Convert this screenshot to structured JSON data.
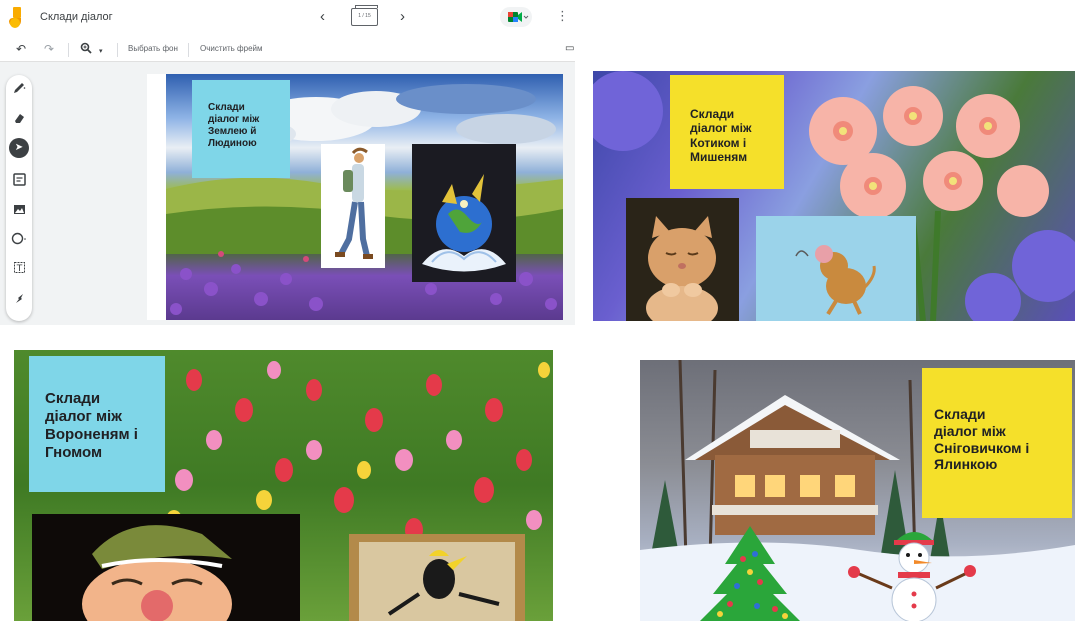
{
  "app": {
    "title": "Склади діалог",
    "frame_counter": "1 / 15",
    "toolbar": {
      "set_background": "Выбрать фон",
      "clear_frame": "Очистить фрейм"
    },
    "icons": {
      "undo": "undo-icon",
      "redo": "redo-icon",
      "zoom": "zoom-icon",
      "pen": "pen-icon",
      "eraser": "eraser-icon",
      "select": "select-icon",
      "sticky": "sticky-note-icon",
      "image": "image-icon",
      "shape": "circle-icon",
      "textbox": "textbox-icon",
      "laser": "laser-icon"
    }
  },
  "slides": [
    {
      "id": "earth-human",
      "note": "Склади діалог між Землею й Людиною",
      "note_lines": [
        "Склади",
        "діалог між",
        "Землею й",
        "Людиною"
      ],
      "note_color": "#7fd6e8"
    },
    {
      "id": "cat-mouse",
      "note": "Склади діалог між Котиком і Мишеням",
      "note_lines": [
        "Склади",
        "діалог між",
        "Котиком і",
        "Мишеням"
      ],
      "note_color": "#f5e02a"
    },
    {
      "id": "raven-gnome",
      "note": "Склади діалог між Вороненям і Гномом",
      "note_lines": [
        "Склади",
        "діалог між",
        "Вороненям і",
        "Гномом"
      ],
      "note_color": "#7fd6e8"
    },
    {
      "id": "snowman-tree",
      "note": "Склади діалог між Сніговичком і Ялинкою",
      "note_lines": [
        "Склади",
        "діалог між",
        "Сніговичком і",
        "Ялинкою"
      ],
      "note_color": "#f5e02a"
    }
  ]
}
